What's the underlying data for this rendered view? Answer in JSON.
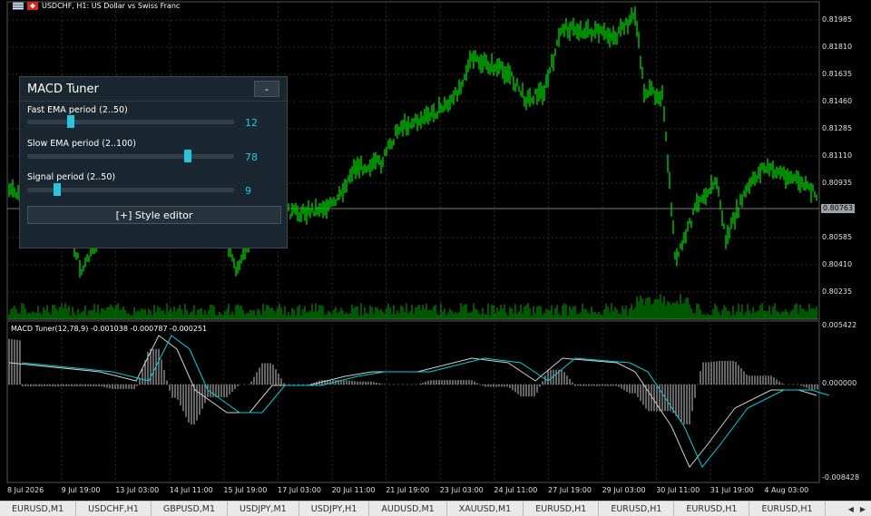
{
  "header": {
    "symbol_title": "USDCHF, H1:  US Dollar vs Swiss Franc"
  },
  "price_axis": [
    "0.81985",
    "0.81810",
    "0.81635",
    "0.81460",
    "0.81285",
    "0.81110",
    "0.80935",
    "0.80585",
    "0.80410",
    "0.80235"
  ],
  "current_price": "0.80763",
  "indicator": {
    "title": "MACD Tuner(12,78,9) -0.001038 -0.000787 -0.000251",
    "axis": [
      "0.005422",
      "0.000000",
      "-0.008428"
    ]
  },
  "time_axis": [
    "8 Jul 2026",
    "9 Jul 19:00",
    "13 Jul 03:00",
    "14 Jul 11:00",
    "15 Jul 19:00",
    "17 Jul 03:00",
    "20 Jul 11:00",
    "21 Jul 19:00",
    "23 Jul 03:00",
    "24 Jul 11:00",
    "27 Jul 19:00",
    "29 Jul 03:00",
    "30 Jul 11:00",
    "31 Jul 19:00",
    "4 Aug 03:00"
  ],
  "panel": {
    "title": "MACD Tuner",
    "minimize_label": "-",
    "sliders": [
      {
        "label": "Fast EMA period (2..50)",
        "value": "12",
        "min": 2,
        "max": 50,
        "current": 12
      },
      {
        "label": "Slow EMA period (2..100)",
        "value": "78",
        "min": 2,
        "max": 100,
        "current": 78
      },
      {
        "label": "Signal period (2..50)",
        "value": "9",
        "min": 2,
        "max": 50,
        "current": 9
      }
    ],
    "style_button_label": "[+] Style editor"
  },
  "tabs": [
    "EURUSD,M1",
    "USDCHF,H1",
    "GBPUSD,M1",
    "USDJPY,M1",
    "USDJPY,H1",
    "AUDUSD,M1",
    "XAUUSD,M1",
    "EURUSD,H1",
    "EURUSD,H1",
    "EURUSD,H1",
    "EURUSD,H1"
  ],
  "colors": {
    "candles": "#00c800",
    "grid": "#2e2e2e",
    "volume": "#00b000",
    "macd_line": "#cfcfcf",
    "signal_line": "#00cfe0",
    "histogram": "#c8c8c8",
    "accent": "#27c6e0"
  }
}
